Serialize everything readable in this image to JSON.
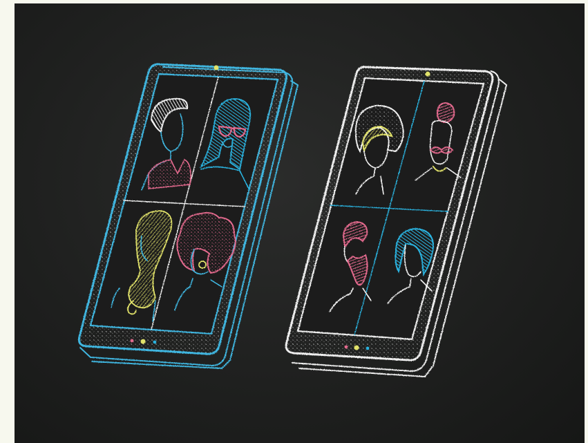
{
  "scene": {
    "palette": {
      "background": "#1f201f",
      "left_phone": "#3fb6e0",
      "right_phone": "#eeeeee",
      "pink": "#e46a8e",
      "yellow": "#e2e36a",
      "cyan": "#2bb3e0",
      "white": "#f2f2f2"
    },
    "left_phone": {
      "icon": "smartphone-icon",
      "participants": [
        {
          "icon": "person-white-quiff-icon"
        },
        {
          "icon": "person-cyan-hair-sunglasses-icon"
        },
        {
          "icon": "person-yellow-long-hair-icon"
        },
        {
          "icon": "person-pink-curly-hair-icon"
        }
      ]
    },
    "right_phone": {
      "icon": "smartphone-icon",
      "participants": [
        {
          "icon": "person-afro-headband-icon"
        },
        {
          "icon": "person-pink-mustache-icon"
        },
        {
          "icon": "person-pink-beard-icon"
        },
        {
          "icon": "person-cyan-bob-hair-icon"
        }
      ]
    }
  }
}
